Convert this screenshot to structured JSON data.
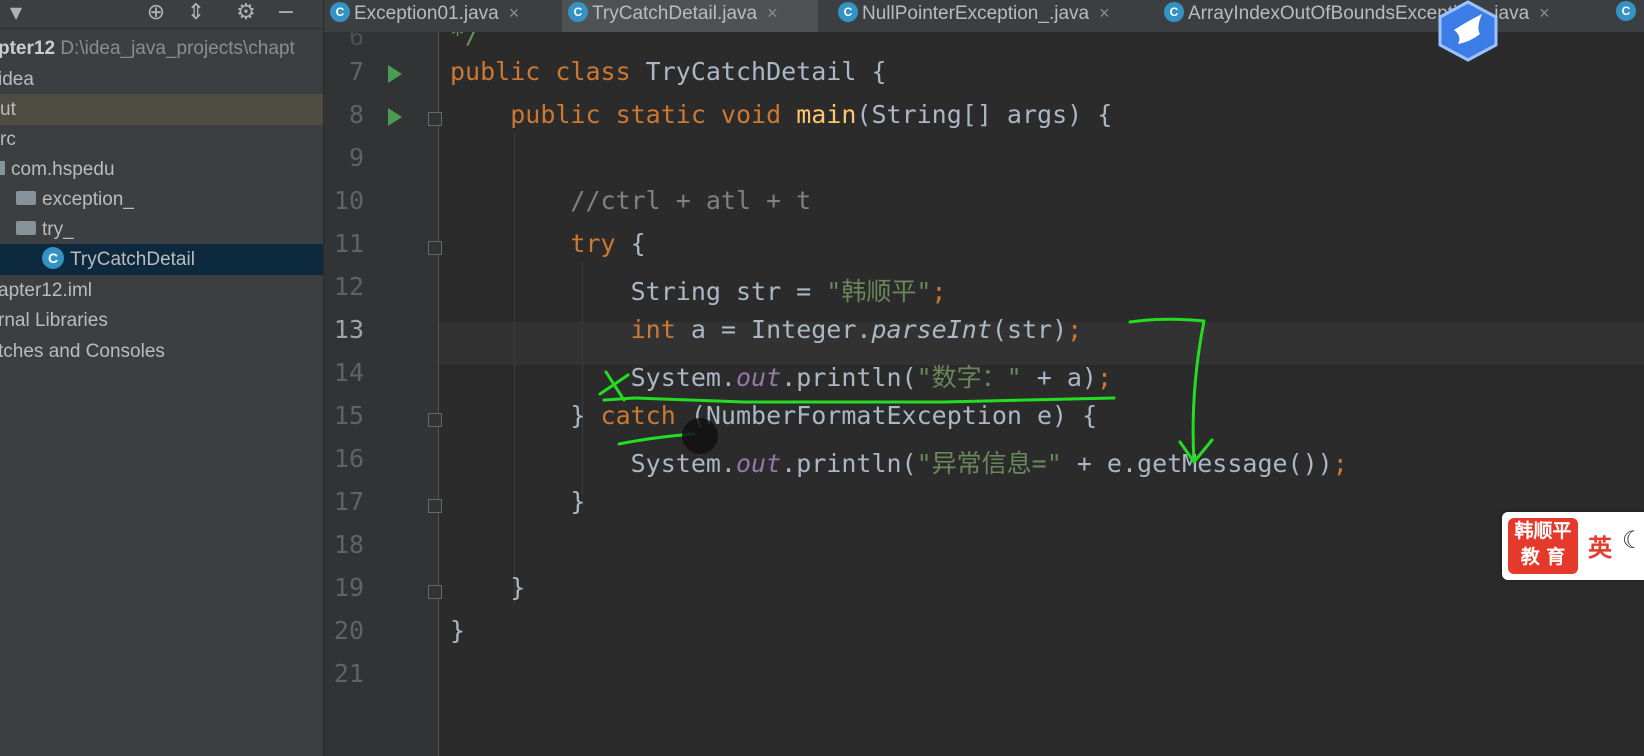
{
  "sidebar": {
    "items": [
      {
        "label": "pter12",
        "path": "D:\\idea_java_projects\\chapt"
      },
      {
        "label": "idea"
      },
      {
        "label": "ut"
      },
      {
        "label": "rc"
      },
      {
        "label": "com.hspedu"
      },
      {
        "label": "exception_"
      },
      {
        "label": "try_"
      },
      {
        "label": "TryCatchDetail"
      },
      {
        "label": "apter12.iml"
      },
      {
        "label": "rnal Libraries"
      },
      {
        "label": "tches and Consoles"
      }
    ]
  },
  "tabs": [
    {
      "label": "Exception01.java"
    },
    {
      "label": "TryCatchDetail.java"
    },
    {
      "label": "NullPointerException_.java"
    },
    {
      "label": "ArrayIndexOutOfBoundsException_.java"
    }
  ],
  "editor": {
    "line_numbers": [
      "7",
      "8",
      "9",
      "10",
      "11",
      "12",
      "13",
      "14",
      "15",
      "16",
      "17",
      "18",
      "19",
      "20",
      "21"
    ],
    "top_fragment": "*/",
    "current_line": "13"
  },
  "brand_widget": {
    "badge_line1": "韩顺平",
    "badge_line2": "教 育",
    "lang": "英"
  },
  "colors": {
    "keyword": "#cc7832",
    "string": "#6a8759",
    "comment": "#808080",
    "annotation": "#22dd22",
    "accent": "#4a88c7"
  }
}
